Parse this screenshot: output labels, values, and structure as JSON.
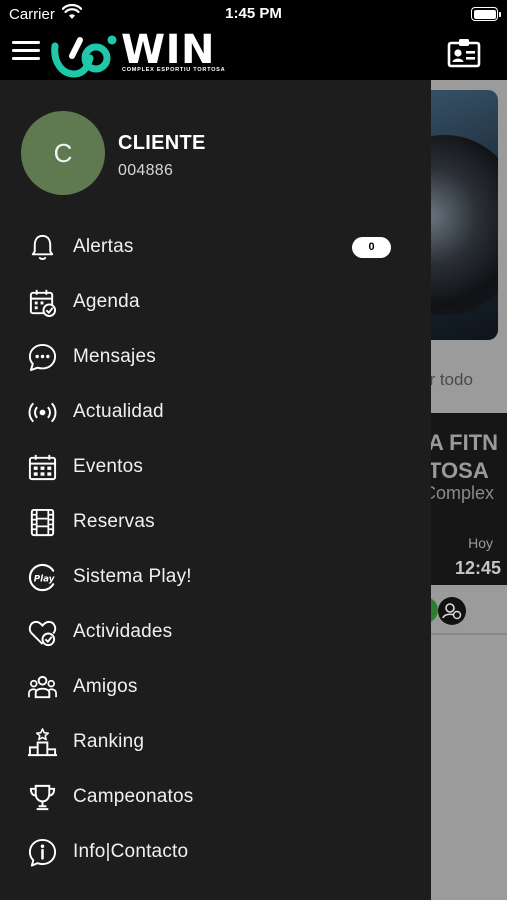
{
  "status_bar": {
    "carrier": "Carrier",
    "time": "1:45 PM"
  },
  "app_bar": {
    "logo_word": "WIN",
    "logo_subtitle": "COMPLEX ESPORTIU TORTOSA",
    "menu_icon": "hamburger-icon",
    "right_icon": "id-card-icon"
  },
  "profile": {
    "initial": "C",
    "name": "CLIENTE",
    "id": "004886",
    "avatar_color": "#5f7a50"
  },
  "menu": {
    "items": [
      {
        "label": "Alertas",
        "icon": "bell-icon",
        "badge": "0"
      },
      {
        "label": "Agenda",
        "icon": "calendar-check-icon"
      },
      {
        "label": "Mensajes",
        "icon": "chat-bubble-icon"
      },
      {
        "label": "Actualidad",
        "icon": "broadcast-icon"
      },
      {
        "label": "Eventos",
        "icon": "calendar-grid-icon"
      },
      {
        "label": "Reservas",
        "icon": "film-strip-icon"
      },
      {
        "label": "Sistema Play!",
        "icon": "play-badge-icon"
      },
      {
        "label": "Actividades",
        "icon": "heart-check-icon"
      },
      {
        "label": "Amigos",
        "icon": "group-icon"
      },
      {
        "label": "Ranking",
        "icon": "podium-icon"
      },
      {
        "label": "Campeonatos",
        "icon": "trophy-icon"
      },
      {
        "label": "Info|Contacto",
        "icon": "info-bubble-icon"
      }
    ]
  },
  "background": {
    "ver_todo": "er todo",
    "event_title": "A FITN\nTOSA",
    "event_subtitle": "Complex",
    "event_day": "Hoy",
    "event_time": "12:45"
  },
  "colors": {
    "drawer_bg": "#1d1d1d",
    "app_bar_bg": "#000000",
    "logo_accent": "#1ec8a8"
  }
}
